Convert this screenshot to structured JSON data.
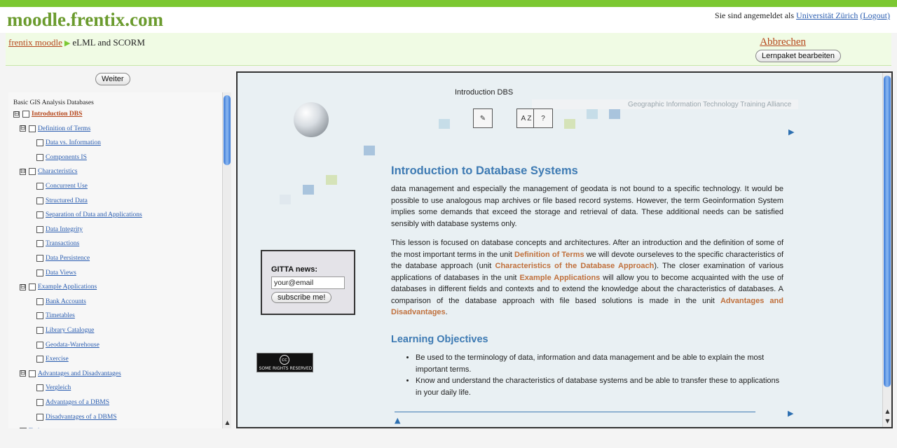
{
  "site": {
    "title": "moodle.frentix.com"
  },
  "login": {
    "prefix": "Sie sind angemeldet als ",
    "user": "Universität Zürich",
    "logout": "(Logout)"
  },
  "breadcrumb": {
    "home": "frentix moodle",
    "separator": "▶",
    "current": "eLML and SCORM"
  },
  "actions": {
    "cancel": "Abbrechen",
    "edit": "Lernpaket bearbeiten",
    "next": "Weiter"
  },
  "toc": {
    "title": "Basic GIS Analysis Databases",
    "items": [
      {
        "label": "Introduction DBS",
        "level": 0,
        "expander": "⊟",
        "active": true
      },
      {
        "label": "Definition of Terms",
        "level": 1,
        "expander": "⊟"
      },
      {
        "label": "Data vs. Information",
        "level": 2
      },
      {
        "label": "Components IS",
        "level": 2
      },
      {
        "label": "Characteristics",
        "level": 1,
        "expander": "⊟"
      },
      {
        "label": "Concurrent Use",
        "level": 2
      },
      {
        "label": "Structured Data",
        "level": 2
      },
      {
        "label": "Separation of Data and Applications",
        "level": 2
      },
      {
        "label": "Data Integrity",
        "level": 2
      },
      {
        "label": "Transactions",
        "level": 2
      },
      {
        "label": "Data Persistence",
        "level": 2
      },
      {
        "label": "Data Views",
        "level": 2
      },
      {
        "label": "Example Applications",
        "level": 1,
        "expander": "⊟"
      },
      {
        "label": "Bank Accounts",
        "level": 2
      },
      {
        "label": "Timetables",
        "level": 2
      },
      {
        "label": "Library Catalogue",
        "level": 2
      },
      {
        "label": "Geodata-Warehouse",
        "level": 2
      },
      {
        "label": "Exercise",
        "level": 2
      },
      {
        "label": "Advantages and Disadvantages",
        "level": 1,
        "expander": "⊟"
      },
      {
        "label": "Vergleich",
        "level": 2
      },
      {
        "label": "Advantages of a DBMS",
        "level": 2
      },
      {
        "label": "Disadvantages of a DBMS",
        "level": 2
      },
      {
        "label": "Tasks",
        "level": 1
      }
    ]
  },
  "lesson": {
    "banner_label": "Introduction DBS",
    "banner_org": "Geographic Information Technology Training Alliance",
    "heading": "Introduction to Database Systems",
    "intro": "data management and especially the management of geodata is not bound to a specific technology. It would be possible to use analogous map archives or file based record systems. However, the term Geoinformation System implies some demands that exceed the storage and retrieval of data. These additional needs can be satisfied sensibly with database systems only.",
    "p2": {
      "t1": "This lesson is focused on database concepts and architectures. After an introduction and the definition of some of the most important terms in the unit ",
      "l1": "Definition of Terms",
      "t2": " we will devote ourseleves to the specific characteristics of the database approach (unit ",
      "l2": "Characteristics of the Database Approach",
      "t3": "). The closer examination of various applications of databases in the unit ",
      "l3": "Example Applications",
      "t4": " will allow you to become acquainted with the use of databases in different fields and contexts and to extend the knowledge about the characteristics of databases. A comparison of the database approach with file based solutions is made in the unit ",
      "l4": "Advantages and Disadvantages",
      "t5": "."
    },
    "objectives_heading": "Learning Objectives",
    "objectives": [
      "Be used to the terminology of data, information and data management and be able to explain the most important terms.",
      "Know and understand the characteristics of database systems and be able to transfer these to applications in your daily life."
    ]
  },
  "news": {
    "title": "GITTA news:",
    "email_value": "your@email",
    "subscribe": "subscribe me!"
  },
  "license": {
    "symbol": "cc",
    "text": "SOME RIGHTS RESERVED"
  },
  "icons": {
    "az_letters": "A Z"
  },
  "colors": {
    "accent_green": "#7cc832",
    "link_blue": "#2a5db0",
    "link_orange": "#c0703c",
    "heading_blue": "#3d7ab3"
  }
}
